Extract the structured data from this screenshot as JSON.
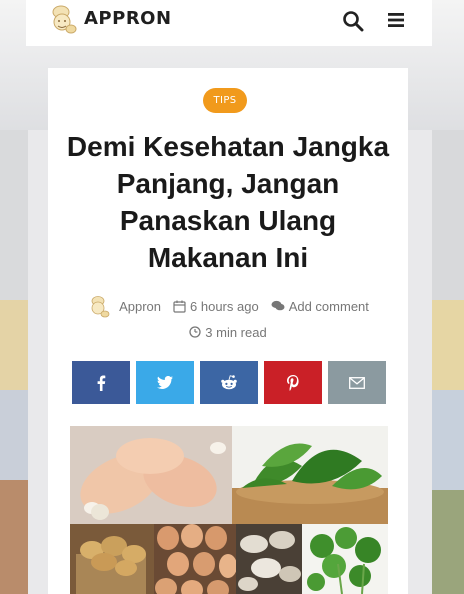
{
  "header": {
    "brand": "APPRON",
    "logo_icon": "chef-mascot-icon",
    "search_icon": "search-icon",
    "menu_icon": "hamburger-menu-icon"
  },
  "article": {
    "category": "TIPS",
    "title": "Demi Kesehatan Jangka Panjang, Jangan Panaskan Ulang Makanan Ini",
    "author": "Appron",
    "posted": "6 hours ago",
    "comment": "Add comment",
    "read_time": "3 min read"
  },
  "share": [
    {
      "network": "facebook",
      "icon": "facebook-icon",
      "color": "#3b5998"
    },
    {
      "network": "twitter",
      "icon": "twitter-icon",
      "color": "#3aa9e8"
    },
    {
      "network": "reddit",
      "icon": "reddit-icon",
      "color": "#3c66a4"
    },
    {
      "network": "pinterest",
      "icon": "pinterest-icon",
      "color": "#ca2027"
    },
    {
      "network": "email",
      "icon": "envelope-icon",
      "color": "#8b9aa0"
    }
  ],
  "colors": {
    "accent": "#f19a1c",
    "title": "#1a1a1a",
    "meta": "#777777"
  }
}
